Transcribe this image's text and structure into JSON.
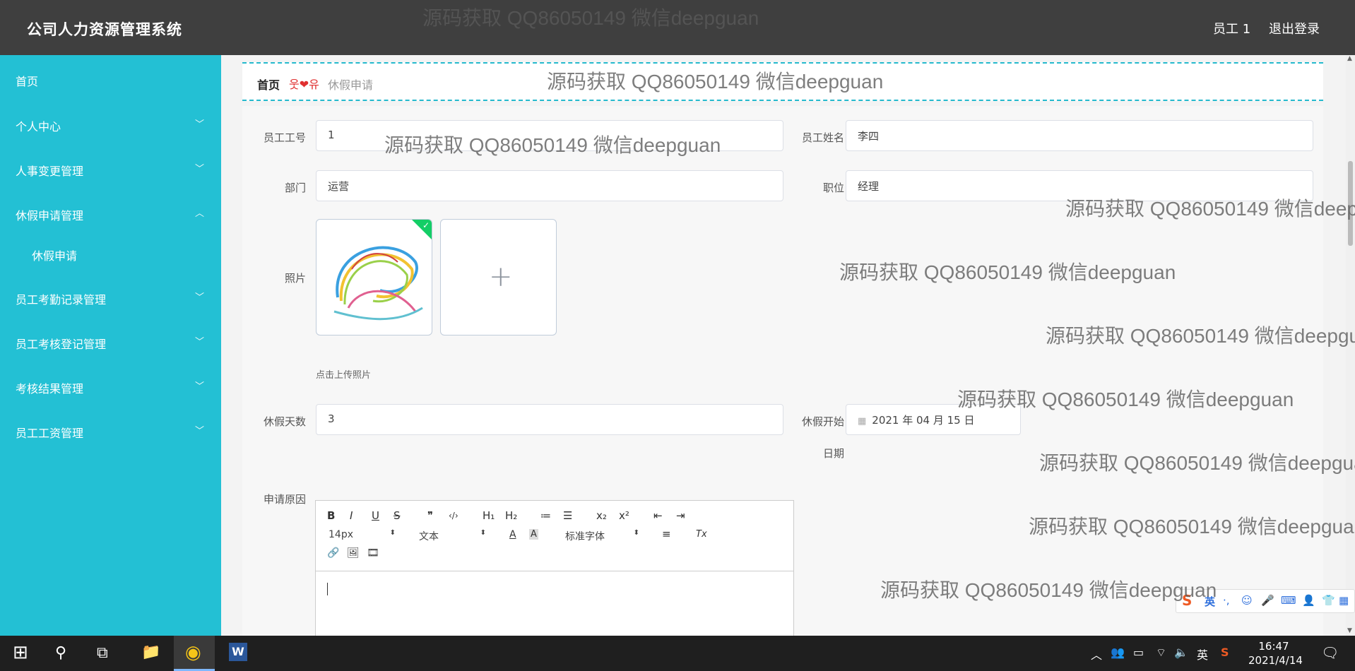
{
  "header": {
    "title": "公司人力资源管理系统",
    "user": "员工 1",
    "logout": "退出登录"
  },
  "sidebar": {
    "items": [
      {
        "label": "首页"
      },
      {
        "label": "个人中心",
        "chevron": "﹀"
      },
      {
        "label": "人事变更管理",
        "chevron": "﹀"
      },
      {
        "label": "休假申请管理",
        "chevron": "︿"
      },
      {
        "label": "休假申请"
      },
      {
        "label": "员工考勤记录管理",
        "chevron": "﹀"
      },
      {
        "label": "员工考核登记管理",
        "chevron": "﹀"
      },
      {
        "label": "考核结果管理",
        "chevron": "﹀"
      },
      {
        "label": "员工工资管理",
        "chevron": "﹀"
      }
    ]
  },
  "breadcrumb": {
    "home": "首页",
    "separator": "웃❤유",
    "current": "休假申请"
  },
  "form": {
    "emp_no_label": "员工工号",
    "emp_no_value": "1",
    "emp_name_label": "员工姓名",
    "emp_name_value": "李四",
    "dept_label": "部门",
    "dept_value": "运营",
    "position_label": "职位",
    "position_value": "经理",
    "photo_label": "照片",
    "upload_plus": "+",
    "upload_hint": "点击上传照片",
    "leave_days_label": "休假天数",
    "leave_days_value": "3",
    "leave_start_label_1": "休假开始",
    "leave_start_label_2": "日期",
    "leave_start_value": "2021 年 04 月 15 日",
    "reason_label": "申请原因"
  },
  "editor": {
    "buttons": [
      "B",
      "I",
      "U",
      "S",
      "❞",
      "‹/›",
      "H₁",
      "H₂",
      "≔",
      "☰",
      "x₂",
      "x²",
      "⇤",
      "⇥"
    ],
    "font_size": "14px",
    "block_type": "文本",
    "font_family": "标准字体",
    "color_btn": "A",
    "bg_btn": "A",
    "align_btn": "≡",
    "clear_btn": "Tx",
    "link_icon": "🔗",
    "image_icon": "🖼",
    "video_icon": "🎞",
    "select_arrow": "⬍"
  },
  "watermark": "源码获取 QQ86050149 微信deepguan",
  "ime": {
    "logo": "S",
    "lang": "英",
    "punct": "·,",
    "emoji": "☺",
    "mic": "🎤",
    "keyboard": "⌨",
    "user": "👤",
    "skin": "👕",
    "grid": "▦"
  },
  "taskbar": {
    "start": "⊞",
    "search": "⚲",
    "taskview": "⧉",
    "explorer": "📁",
    "chrome": "◉",
    "word": "W",
    "tray_up": "︿",
    "tray_people": "👥",
    "tray_battery": "▭",
    "tray_wifi": "⌔",
    "tray_volume": "🔈",
    "tray_lang": "英",
    "tray_ime": "S",
    "time": "16:47",
    "date": "2021/4/14",
    "notify": "🗨"
  }
}
